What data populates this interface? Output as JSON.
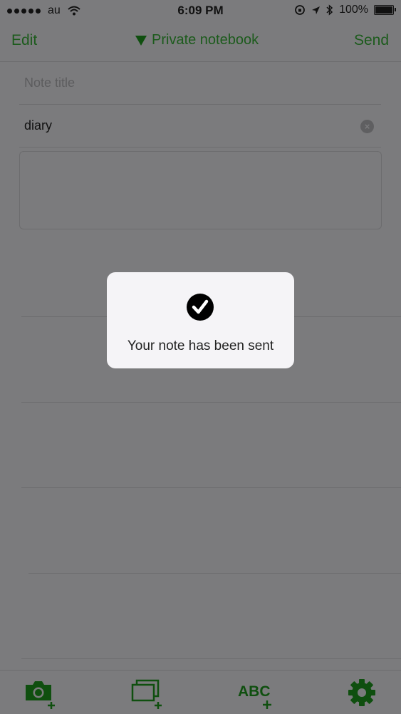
{
  "status": {
    "carrier": "au",
    "time": "6:09 PM",
    "battery_text": "100%"
  },
  "nav": {
    "left_label": "Edit",
    "notebook": "Private notebook",
    "right_label": "Send"
  },
  "note": {
    "title_placeholder": "Note title",
    "tag_value": "diary"
  },
  "toast": {
    "message": "Your note has been sent"
  },
  "toolbar": {
    "abc_label": "ABC"
  },
  "colors": {
    "accent": "#1c5b1c",
    "overlay": "#7b7b7d",
    "toast_bg": "#f5f4f7"
  }
}
